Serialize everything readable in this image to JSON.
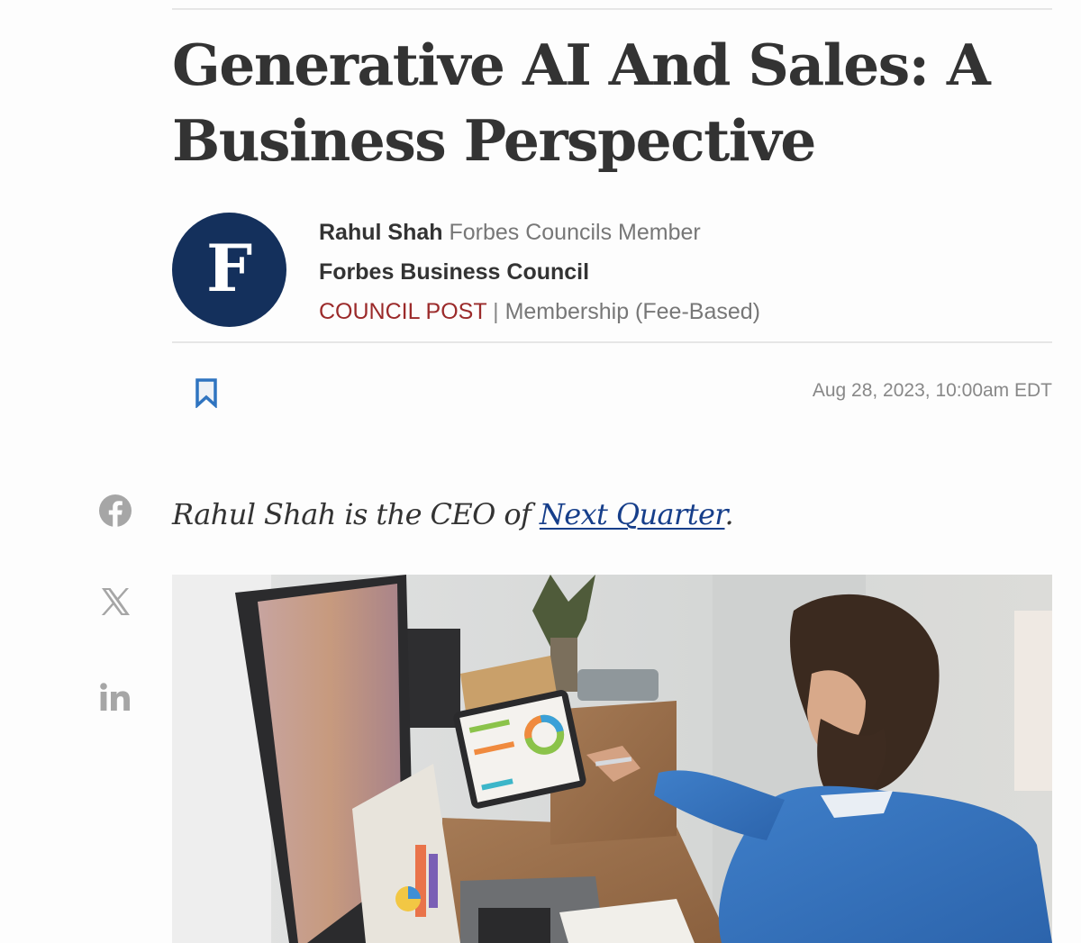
{
  "article": {
    "headline": "Generative AI And Sales: A Business Perspective",
    "author": {
      "name": "Rahul Shah",
      "role": "Forbes Councils Member",
      "council": "Forbes Business Council",
      "post_type": "COUNCIL POST",
      "separator": "|",
      "membership": "Membership (Fee-Based)",
      "avatar_letter": "F"
    },
    "dateline": "Aug 28, 2023, 10:00am EDT",
    "intro": {
      "prefix": "Rahul Shah is the CEO of ",
      "link_text": "Next Quarter",
      "suffix": "."
    },
    "hero_image": {
      "description": "Bearded man in blue sweater pointing at a tablet showing charts, with monitors and laptop on a wooden desk"
    }
  },
  "share": {
    "items": [
      {
        "icon": "facebook-icon",
        "label": "Facebook"
      },
      {
        "icon": "x-icon",
        "label": "X"
      },
      {
        "icon": "linkedin-icon",
        "label": "LinkedIn"
      }
    ]
  },
  "actions": {
    "bookmark_icon": "bookmark-icon"
  },
  "colors": {
    "headline": "#333333",
    "avatar_bg": "#14305c",
    "council_post": "#9b2a2a",
    "link": "#163e8a",
    "bookmark": "#2f74c0",
    "share_icons": "#a6a6a6",
    "muted_text": "#777777"
  }
}
